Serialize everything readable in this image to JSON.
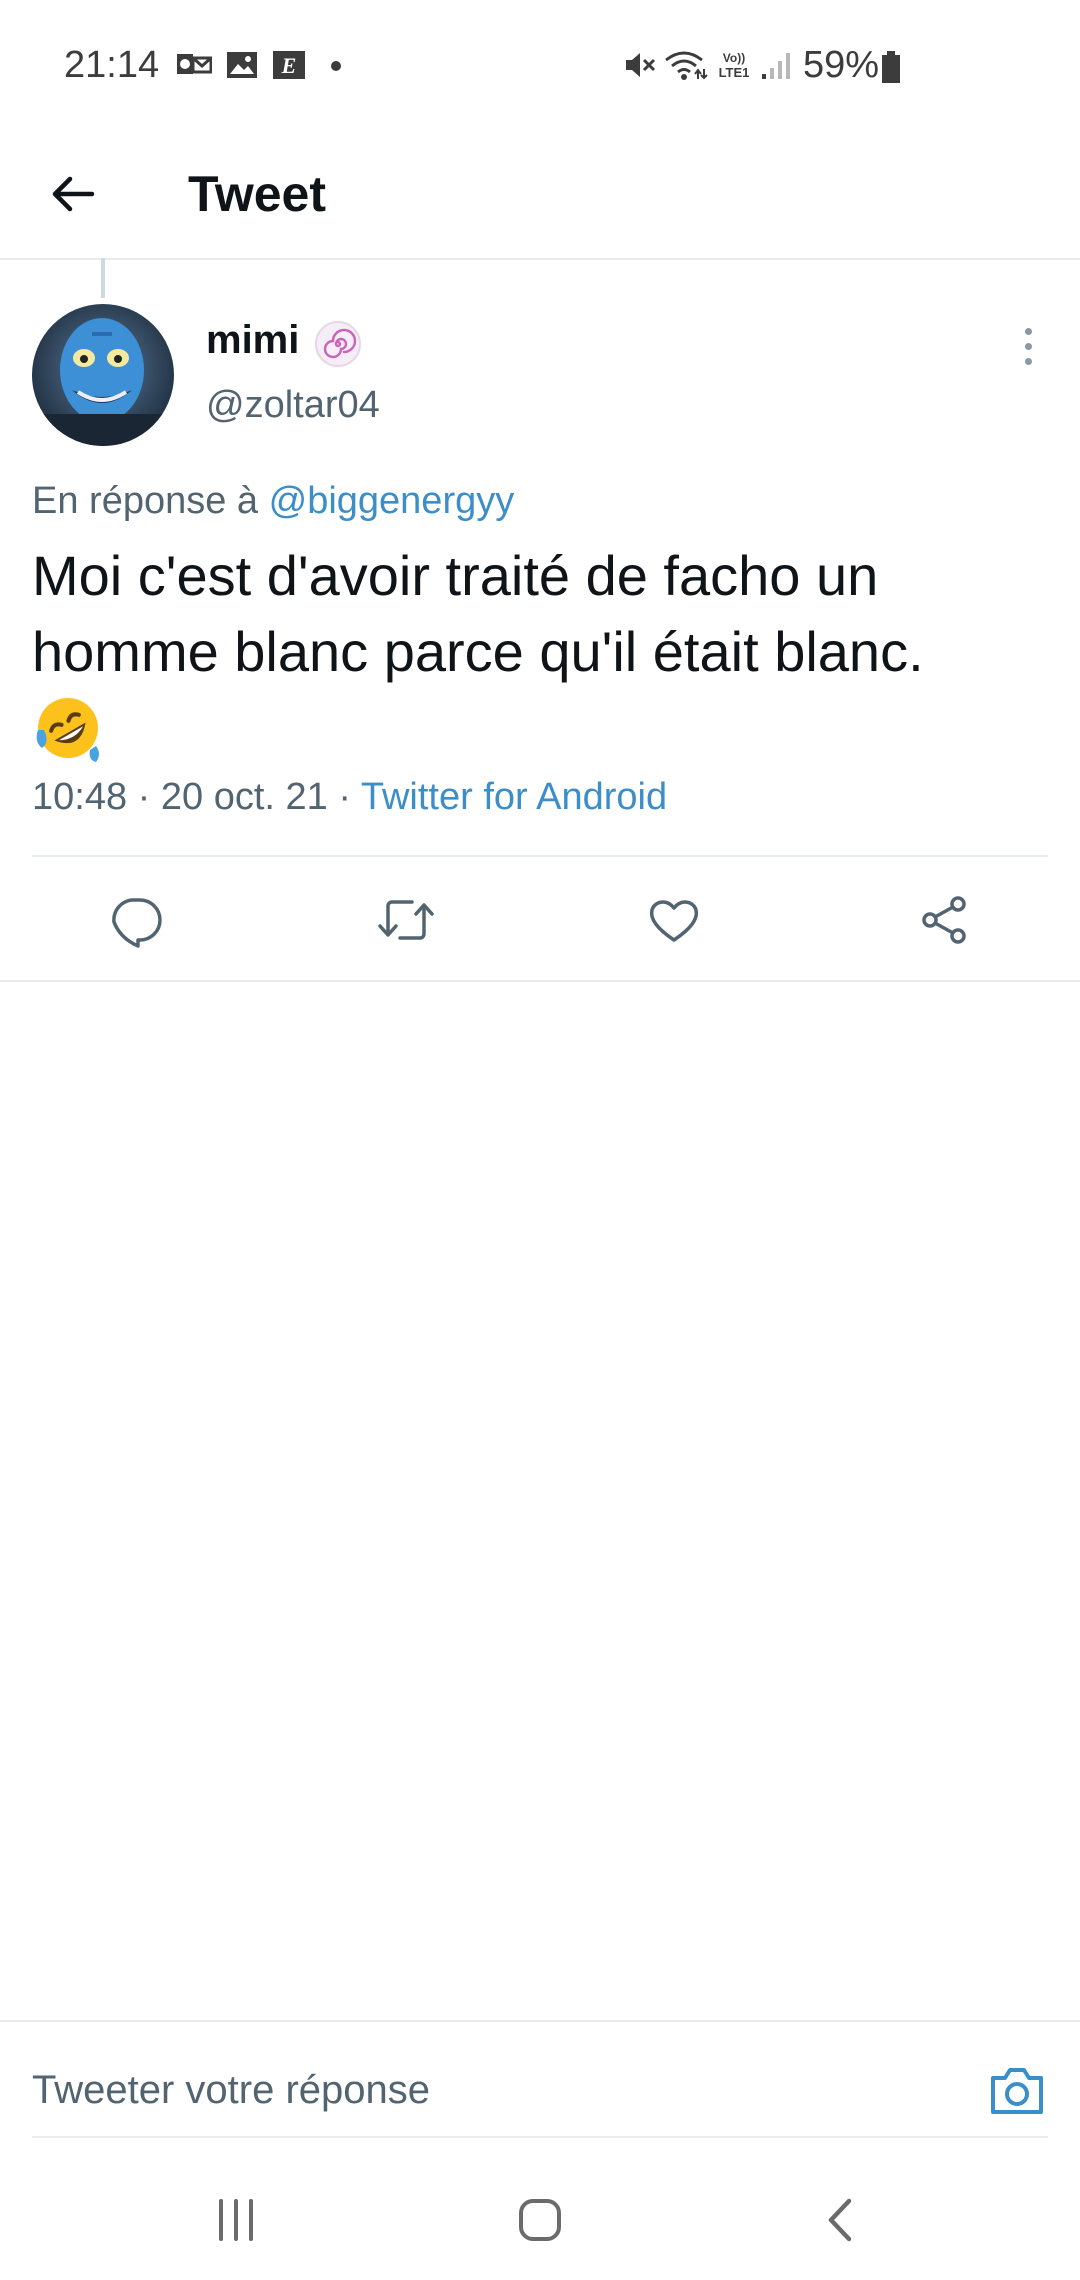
{
  "status_bar": {
    "time": "21:14",
    "battery_percent": "59%",
    "icons": [
      "outlook-icon",
      "gallery-icon",
      "lequipe-icon",
      "dot-icon",
      "mute-icon",
      "wifi-icon",
      "volte-lte-icon",
      "signal-icon",
      "battery-icon"
    ]
  },
  "header": {
    "title": "Tweet",
    "back_icon": "arrow-left-icon"
  },
  "tweet": {
    "author_name": "mimi",
    "author_handle": "@zoltar04",
    "badge_icon": "swirl-badge-icon",
    "reply_prefix": "En réponse à",
    "reply_mention": "@biggenergyy",
    "text": "Moi c'est d'avoir traité de facho un homme blanc parce qu'il était blanc.",
    "emoji": "rolling-on-floor-laughing-emoji",
    "timestamp": "10:48 · 20 oct. 21 ·",
    "source": "Twitter for Android"
  },
  "actions": {
    "items": [
      "reply-icon",
      "retweet-icon",
      "like-icon",
      "share-icon"
    ]
  },
  "composer": {
    "placeholder": "Tweeter votre réponse",
    "camera_icon": "camera-icon"
  },
  "nav_bar": {
    "items": [
      "recent-apps-icon",
      "home-icon",
      "back-icon"
    ]
  },
  "colors": {
    "accent": "#3b8ec8",
    "secondary_text": "#536471",
    "divider": "#e6ecf0"
  }
}
